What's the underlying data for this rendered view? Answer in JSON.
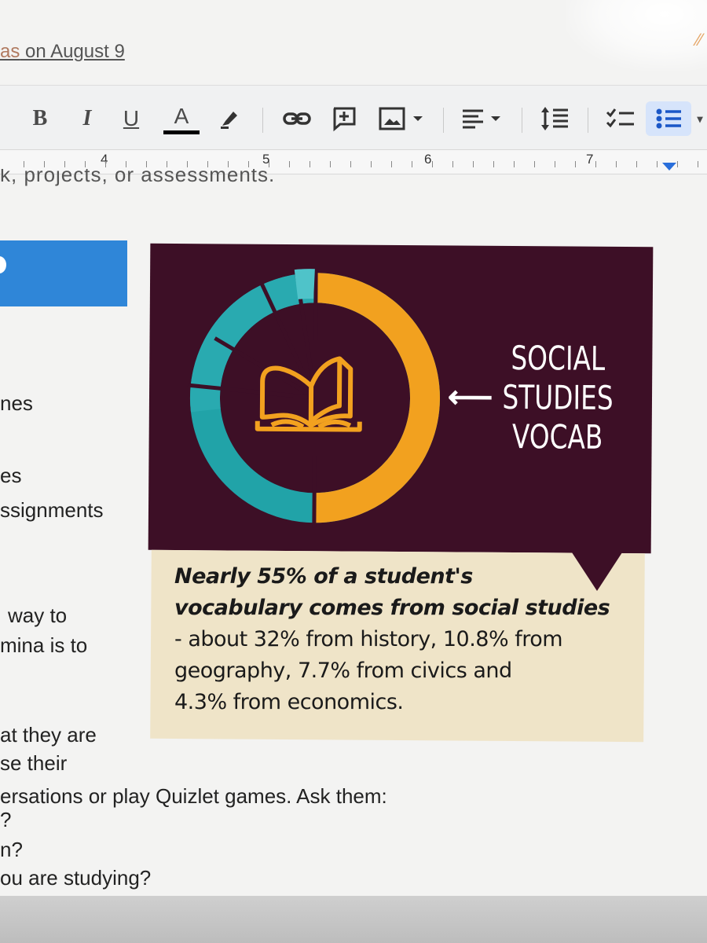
{
  "header": {
    "last_edit_faded": "as",
    "last_edit_text": " on August 9"
  },
  "toolbar": {
    "bold_label": "B",
    "italic_label": "I",
    "underline_label": "U",
    "text_color_label": "A",
    "icons": [
      "highlight-icon",
      "link-icon",
      "comment-icon",
      "image-icon",
      "align-icon",
      "line-spacing-icon",
      "checklist-icon",
      "bulleted-list-icon"
    ]
  },
  "ruler": {
    "labels": [
      "4",
      "5",
      "6",
      "7"
    ]
  },
  "document": {
    "cutoff_line": "k, projects, or assessments.",
    "fragments": [
      "nes",
      "es",
      "ssignments",
      "way to",
      "mina is to",
      "at they are",
      "se their",
      "ersations or play Quizlet games.  Ask them:",
      "?",
      "n?",
      "ou are studying?"
    ]
  },
  "infographic": {
    "heading_lines": [
      "SOCIAL",
      "STUDIES",
      "VOCAB"
    ],
    "arrow": "⟵",
    "caption_bold_1": "Nearly 55% of a student's",
    "caption_bold_2": "vocabulary comes from social studies",
    "caption_rest_1": "- about 32% from history, 10.8% from",
    "caption_rest_2": "geography, 7.7% from civics and",
    "caption_rest_3": "4.3% from economics.",
    "colors": {
      "background": "#3d0f26",
      "orange": "#f2a11f",
      "teal": "#21a3a8",
      "light_teal": "#3fb9c0",
      "caption_bg": "#efe4c8"
    }
  }
}
